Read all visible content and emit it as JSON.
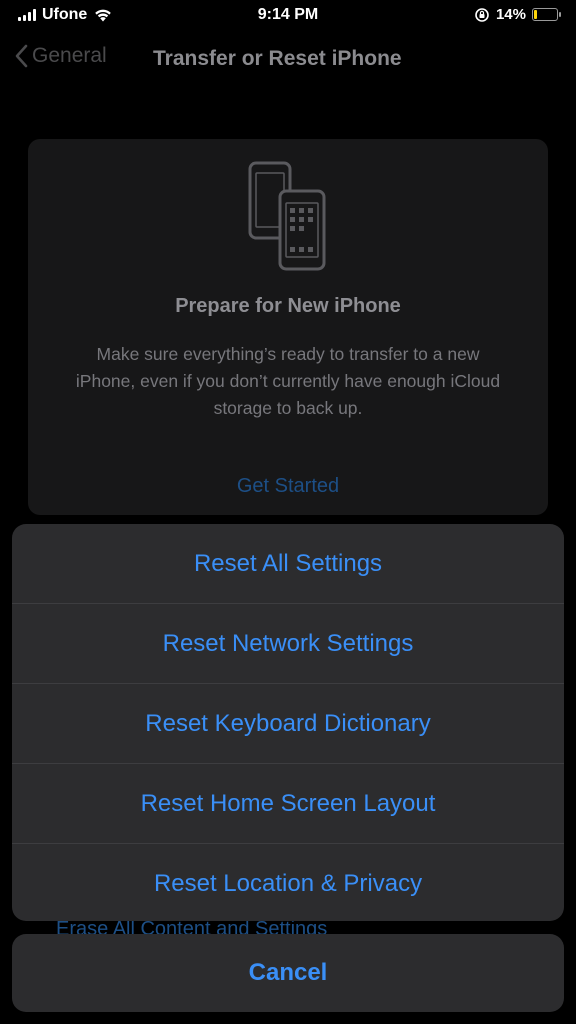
{
  "status_bar": {
    "carrier": "Ufone",
    "time": "9:14 PM",
    "battery_percent": "14%",
    "battery_level": 0.14,
    "icons": [
      "signal-icon",
      "wifi-icon",
      "orientation-lock-icon",
      "battery-icon"
    ]
  },
  "nav": {
    "back_label": "General",
    "title": "Transfer or Reset iPhone"
  },
  "card": {
    "icon": "phones-transfer-icon",
    "title": "Prepare for New iPhone",
    "description": "Make sure everything’s ready to transfer to a new iPhone, even if you don’t currently have enough iCloud storage to back up.",
    "link": "Get Started"
  },
  "background_item": "Erase All Content and Settings",
  "action_sheet": {
    "items": [
      {
        "label": "Reset All Settings"
      },
      {
        "label": "Reset Network Settings"
      },
      {
        "label": "Reset Keyboard Dictionary"
      },
      {
        "label": "Reset Home Screen Layout"
      },
      {
        "label": "Reset Location & Privacy"
      }
    ],
    "cancel": "Cancel"
  },
  "colors": {
    "accent": "#3a8ff7",
    "sheet_bg": "#2c2c2e",
    "battery_low": "#ffd60a"
  }
}
